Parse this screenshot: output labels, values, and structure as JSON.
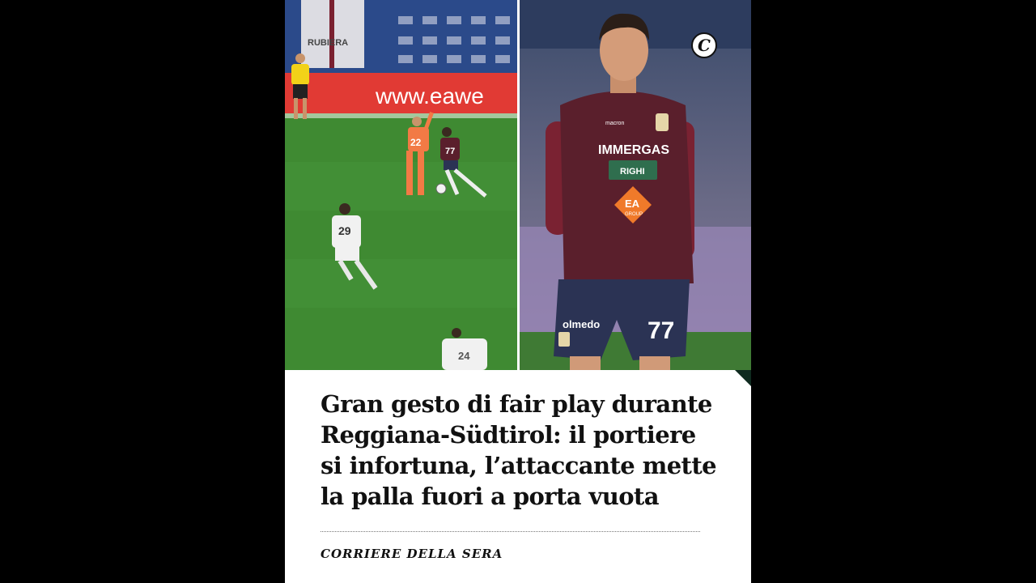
{
  "post": {
    "headline": "Gran gesto di fair play durante\nReggiana-Südtirol: il portiere\nsi infortuna, l’attaccante mette\nla palla fuori a porta vuota",
    "source": "CORRIERE DELLA SERA",
    "logo_letter": "C",
    "logo_icon": "corriere-c-icon"
  },
  "photo_left": {
    "sign_text": "RUBIERA",
    "banner_text": "www.eawe",
    "keeper_number": "22",
    "attacker_number": "77",
    "defender_number": "29",
    "bottom_player_number": "24"
  },
  "photo_right": {
    "sponsor_main": "IMMERGAS",
    "sponsor_secondary": "RIGHI",
    "sponsor_logo": "EA",
    "sponsor_logo_sub": "GROUP",
    "shorts_sponsor": "olmedo",
    "shorts_number": "77",
    "kit_brand": "macron"
  },
  "colors": {
    "pitch": "#3f8a32",
    "kit_maroon": "#5a1f2c",
    "shorts_navy": "#2b3354",
    "banner_red": "#e13a34",
    "background": "#000000"
  }
}
